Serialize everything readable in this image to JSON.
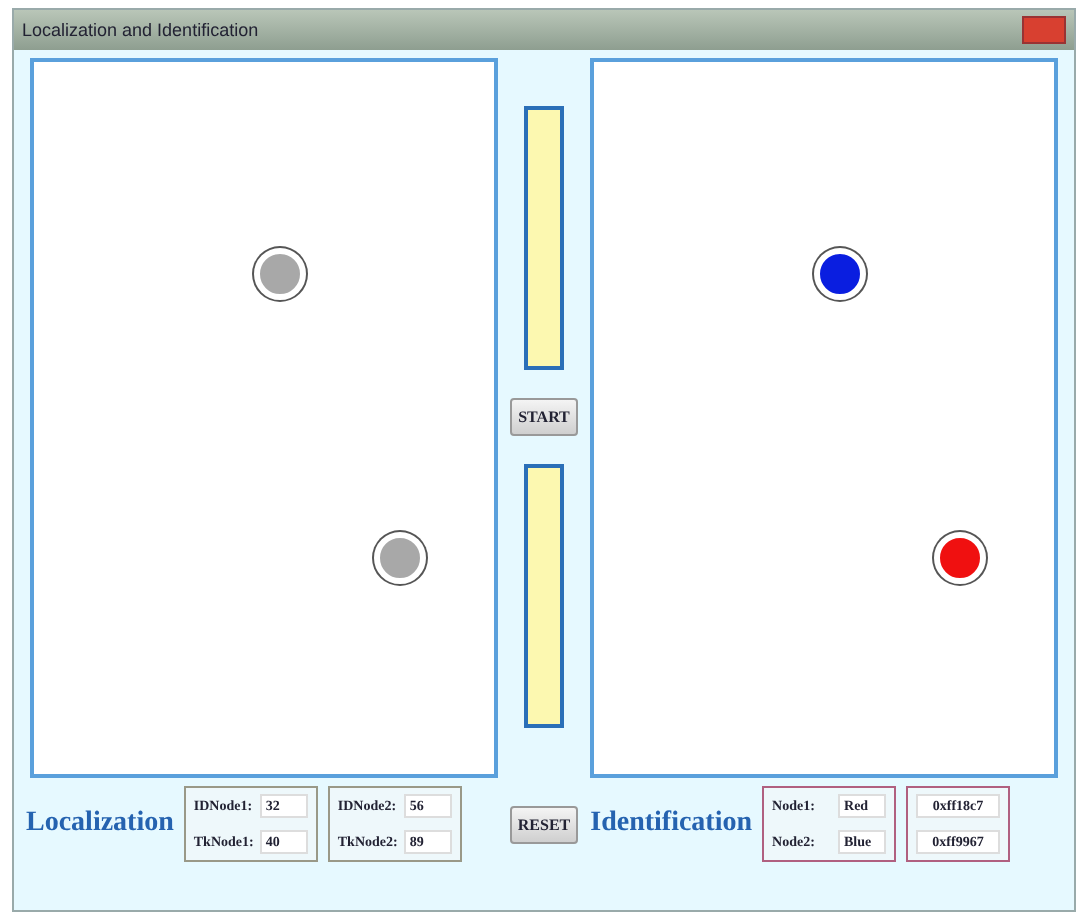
{
  "window": {
    "title": "Localization and Identification"
  },
  "localization": {
    "nodes": [
      {
        "color": "#a8a8a8"
      },
      {
        "color": "#a8a8a8"
      }
    ],
    "label": "Localization",
    "groups": [
      [
        {
          "label": "IDNode1:",
          "value": "32"
        },
        {
          "label": "TkNode1:",
          "value": "40"
        }
      ],
      [
        {
          "label": "IDNode2:",
          "value": "56"
        },
        {
          "label": "TkNode2:",
          "value": "89"
        }
      ]
    ]
  },
  "controls": {
    "start": "START",
    "reset": "RESET"
  },
  "meters": [
    {
      "level": 1
    },
    {
      "level": 1
    }
  ],
  "identification": {
    "nodes": [
      {
        "color": "#0a1ee0"
      },
      {
        "color": "#f01010"
      }
    ],
    "label": "Identification",
    "groups": [
      [
        {
          "label": "Node1:",
          "value": "Red"
        },
        {
          "label": "Node2:",
          "value": "Blue"
        }
      ],
      [
        {
          "value": "0xff18c7"
        },
        {
          "value": "0xff9967"
        }
      ]
    ]
  }
}
